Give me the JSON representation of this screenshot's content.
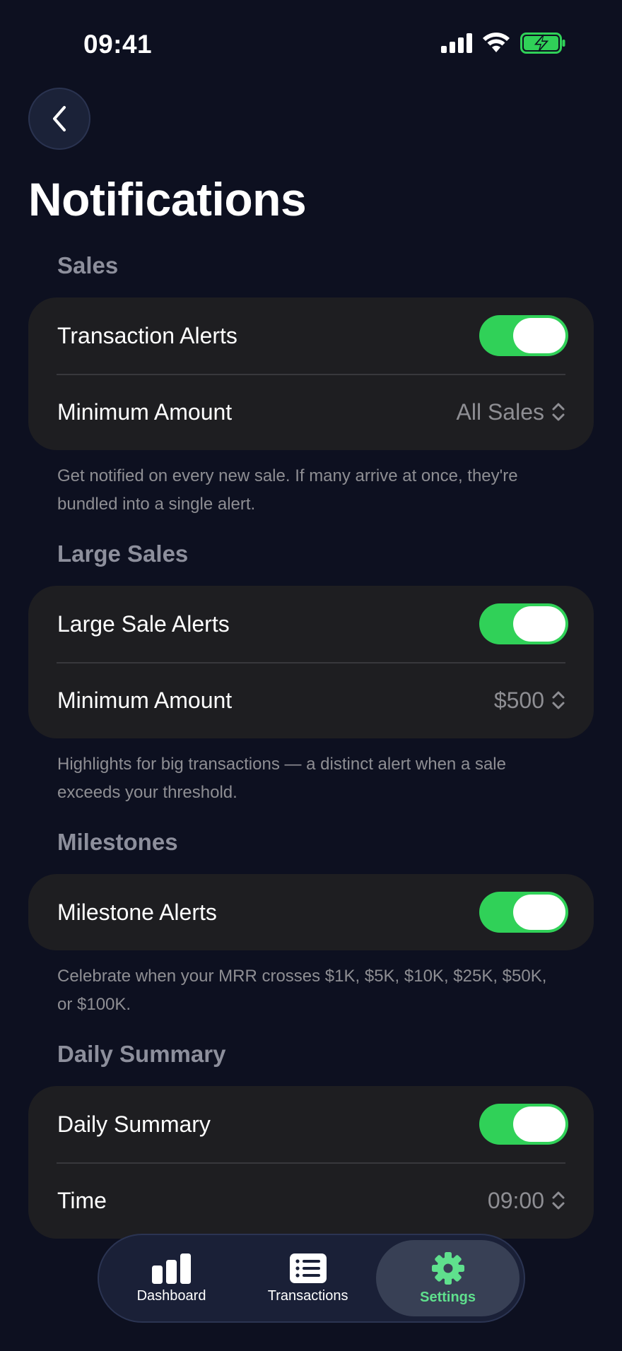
{
  "status_bar": {
    "time": "09:41"
  },
  "header": {
    "title": "Notifications"
  },
  "sections": {
    "sales": {
      "header": "Sales",
      "toggle_label": "Transaction Alerts",
      "toggle_on": true,
      "picker_label": "Minimum Amount",
      "picker_value": "All Sales",
      "footnote": "Get notified on every new sale. If many arrive at once, they're bundled into a single alert."
    },
    "large_sales": {
      "header": "Large Sales",
      "toggle_label": "Large Sale Alerts",
      "toggle_on": true,
      "picker_label": "Minimum Amount",
      "picker_value": "$500",
      "footnote": "Highlights for big transactions — a distinct alert when a sale exceeds your threshold."
    },
    "milestones": {
      "header": "Milestones",
      "toggle_label": "Milestone Alerts",
      "toggle_on": true,
      "footnote": "Celebrate when your MRR crosses $1K, $5K, $10K, $25K, $50K, or $100K."
    },
    "daily_summary": {
      "header": "Daily Summary",
      "toggle_label": "Daily Summary",
      "toggle_on": true,
      "picker_label": "Time",
      "picker_value": "09:00"
    }
  },
  "tab_bar": {
    "tabs": [
      {
        "label": "Dashboard",
        "icon": "bar-chart-icon",
        "active": false
      },
      {
        "label": "Transactions",
        "icon": "list-icon",
        "active": false
      },
      {
        "label": "Settings",
        "icon": "gear-icon",
        "active": true
      }
    ]
  },
  "colors": {
    "background": "#0d1020",
    "card": "#1e1e21",
    "toggle_on": "#30d158",
    "active_tab_accent": "#5fe08d",
    "battery": "#30d158"
  }
}
